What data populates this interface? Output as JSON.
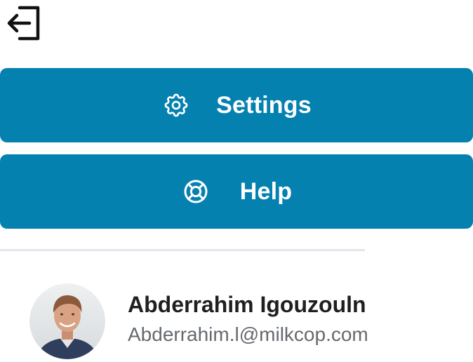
{
  "menu": {
    "logout_icon": "logout-icon",
    "settings": {
      "label": "Settings",
      "icon": "gear-icon"
    },
    "help": {
      "label": "Help",
      "icon": "lifebuoy-icon"
    }
  },
  "user": {
    "name": "Abderrahim Igouzouln",
    "email": "Abderrahim.l@milkcop.com"
  },
  "colors": {
    "accent": "#0581b0",
    "divider": "#e2e6ea",
    "name_text": "#1f1f1f",
    "email_text": "#666a6e"
  }
}
